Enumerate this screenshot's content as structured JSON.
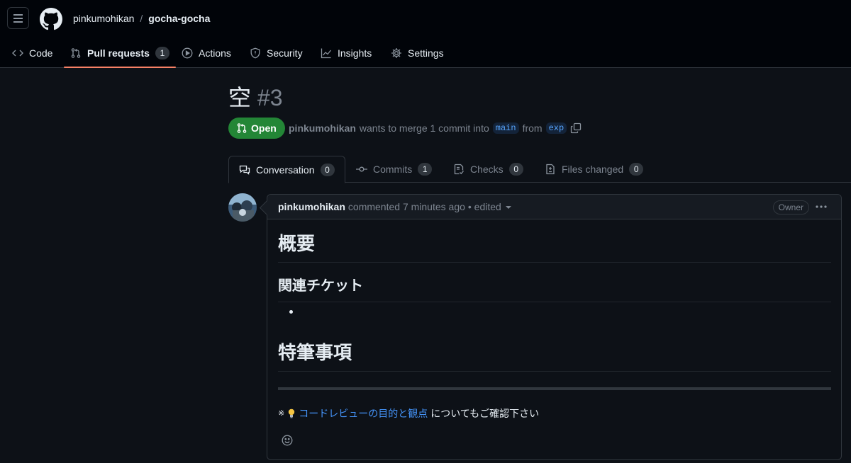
{
  "header": {
    "owner": "pinkumohikan",
    "separator": "/",
    "repo": "gocha-gocha"
  },
  "repo_nav": [
    {
      "label": "Code",
      "icon": "code-icon"
    },
    {
      "label": "Pull requests",
      "icon": "git-pull-request-icon",
      "count": "1",
      "active": true
    },
    {
      "label": "Actions",
      "icon": "play-icon"
    },
    {
      "label": "Security",
      "icon": "shield-icon"
    },
    {
      "label": "Insights",
      "icon": "graph-icon"
    },
    {
      "label": "Settings",
      "icon": "gear-icon"
    }
  ],
  "pr": {
    "title": "空",
    "number": "#3",
    "state": "Open",
    "author": "pinkumohikan",
    "merge_text": "wants to merge 1 commit into",
    "base_branch": "main",
    "from_text": "from",
    "head_branch": "exp"
  },
  "pr_tabs": [
    {
      "label": "Conversation",
      "count": "0",
      "icon": "comment-discussion-icon",
      "active": true
    },
    {
      "label": "Commits",
      "count": "1",
      "icon": "git-commit-icon"
    },
    {
      "label": "Checks",
      "count": "0",
      "icon": "checklist-icon"
    },
    {
      "label": "Files changed",
      "count": "0",
      "icon": "file-diff-icon"
    }
  ],
  "comment": {
    "author": "pinkumohikan",
    "meta": "commented 7 minutes ago",
    "edited": "• edited",
    "role_badge": "Owner",
    "body": {
      "h1_summary": "概要",
      "h2_tickets": "関連チケット",
      "h1_notes": "特筆事項",
      "note_mark": "※",
      "note_link": "コードレビューの目的と観点",
      "note_rest": "についてもご確認下さい"
    }
  },
  "colors": {
    "background": "#0d1117",
    "header_bg": "#010409",
    "open_green": "#238636",
    "link_blue": "#4493f8",
    "active_underline": "#f78166"
  }
}
